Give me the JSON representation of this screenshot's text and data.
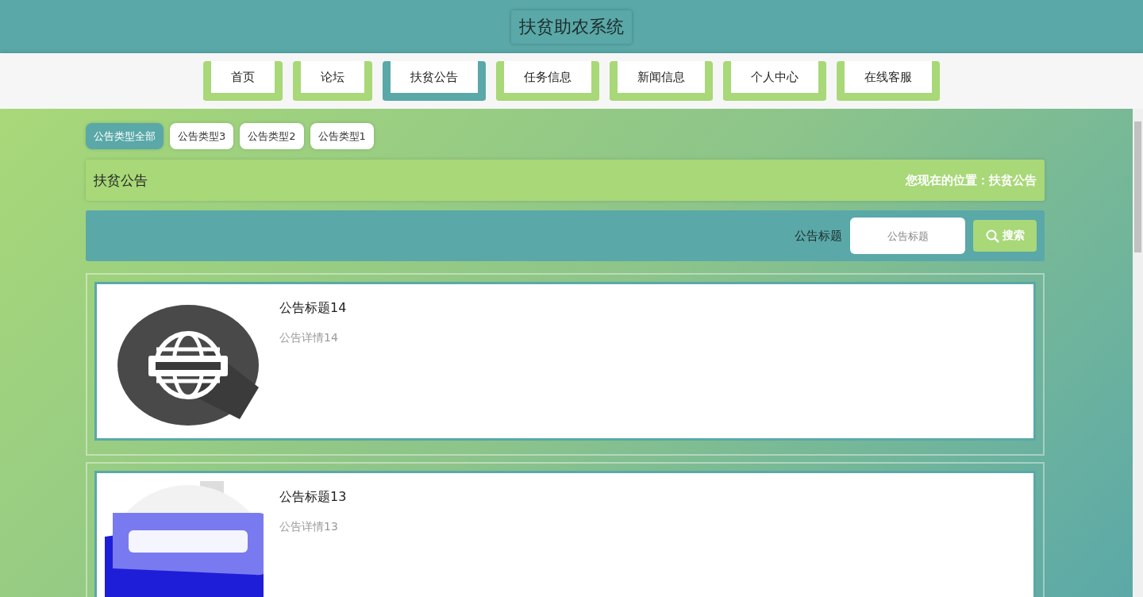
{
  "header": {
    "title": "扶贫助农系统"
  },
  "nav": [
    {
      "label": "首页",
      "selected": false
    },
    {
      "label": "论坛",
      "selected": false
    },
    {
      "label": "扶贫公告",
      "selected": true
    },
    {
      "label": "任务信息",
      "selected": false
    },
    {
      "label": "新闻信息",
      "selected": false
    },
    {
      "label": "个人中心",
      "selected": false
    },
    {
      "label": "在线客服",
      "selected": false
    }
  ],
  "filters": [
    {
      "label": "公告类型全部",
      "selected": true
    },
    {
      "label": "公告类型3",
      "selected": false
    },
    {
      "label": "公告类型2",
      "selected": false
    },
    {
      "label": "公告类型1",
      "selected": false
    }
  ],
  "section": {
    "title": "扶贫公告",
    "breadcrumb": "您现在的位置：扶贫公告"
  },
  "search": {
    "label": "公告标题",
    "placeholder": "公告标题",
    "button": "搜索"
  },
  "notices": [
    {
      "title": "公告标题14",
      "detail": "公告详情14"
    },
    {
      "title": "公告标题13",
      "detail": "公告详情13"
    }
  ]
}
